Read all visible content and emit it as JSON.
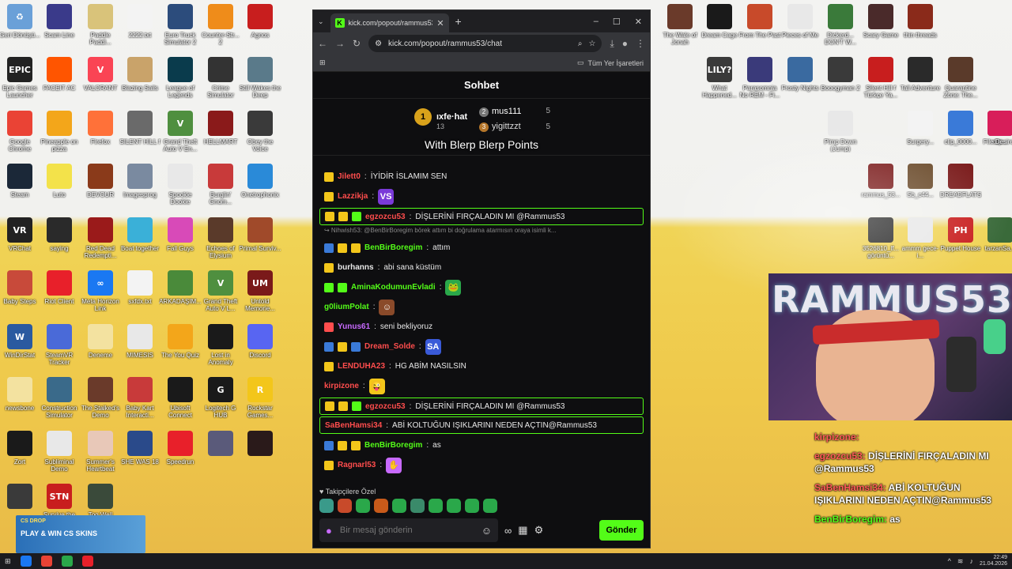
{
  "desktop": {
    "icons": [
      {
        "label": "Geri Dönüşü...",
        "color": "#6aa0d8",
        "glyph": "♻"
      },
      {
        "label": "Scam Line",
        "color": "#3a3a8a",
        "glyph": ""
      },
      {
        "label": "Paddle Paddl...",
        "color": "#d9c37a",
        "glyph": ""
      },
      {
        "label": "2222.txt",
        "color": "#f3f3f3",
        "glyph": ""
      },
      {
        "label": "Euro Truck Simulator 2",
        "color": "#2c4c7c",
        "glyph": ""
      },
      {
        "label": "Counter-Str... 2",
        "color": "#ef8c1a",
        "glyph": ""
      },
      {
        "label": "Agnos",
        "color": "#c81e1e",
        "glyph": ""
      },
      {
        "label": "Epic Games Launcher",
        "color": "#222",
        "glyph": "EPIC"
      },
      {
        "label": "FACEIT AC",
        "color": "#ff5500",
        "glyph": ""
      },
      {
        "label": "VALORANT",
        "color": "#fa4454",
        "glyph": "V"
      },
      {
        "label": "Blazing Sails",
        "color": "#c9a36a",
        "glyph": ""
      },
      {
        "label": "League of Legends",
        "color": "#0a3b4c",
        "glyph": ""
      },
      {
        "label": "Crime Simulator",
        "color": "#333",
        "glyph": ""
      },
      {
        "label": "Still Wakes the Deep",
        "color": "#5a7a8a",
        "glyph": ""
      },
      {
        "label": "Google Chrome",
        "color": "#ea4335",
        "glyph": ""
      },
      {
        "label": "Pineapple on pizza",
        "color": "#f3a61a",
        "glyph": ""
      },
      {
        "label": "Firefox",
        "color": "#ff7139",
        "glyph": ""
      },
      {
        "label": "SILENT HILL f",
        "color": "#6a6a6a",
        "glyph": ""
      },
      {
        "label": "Grand Theft Auto V En...",
        "color": "#4f8f3f",
        "glyph": "V"
      },
      {
        "label": "HELLMART",
        "color": "#8a1a1a",
        "glyph": ""
      },
      {
        "label": "Obey the Voice",
        "color": "#3a3a3a",
        "glyph": ""
      },
      {
        "label": "Steam",
        "color": "#1b2838",
        "glyph": ""
      },
      {
        "label": "Luto",
        "color": "#f3e24a",
        "glyph": ""
      },
      {
        "label": "DEVOUR",
        "color": "#8a3a1a",
        "glyph": ""
      },
      {
        "label": "Imagesprog",
        "color": "#7a8aa0",
        "glyph": ""
      },
      {
        "label": "Spookie Dookie",
        "color": "#e8e8e8",
        "glyph": ""
      },
      {
        "label": "Burglin' Gnom...",
        "color": "#c83a3a",
        "glyph": ""
      },
      {
        "label": "Onetrophonix",
        "color": "#2a8ad8",
        "glyph": ""
      },
      {
        "label": "VRChat",
        "color": "#222",
        "glyph": "VR"
      },
      {
        "label": "saying",
        "color": "#2a2a2a",
        "glyph": ""
      },
      {
        "label": "Red Dead Redempti...",
        "color": "#9a1a1a",
        "glyph": ""
      },
      {
        "label": "Boat together",
        "color": "#3ab0d8",
        "glyph": ""
      },
      {
        "label": "Fall Guys",
        "color": "#d84ab8",
        "glyph": ""
      },
      {
        "label": "Echoes of Elysium",
        "color": "#5a3a2a",
        "glyph": ""
      },
      {
        "label": "Primal Surviv...",
        "color": "#a04a2a",
        "glyph": ""
      },
      {
        "label": "Baby Steps",
        "color": "#c84a3a",
        "glyph": ""
      },
      {
        "label": "Riot Client",
        "color": "#e8202a",
        "glyph": ""
      },
      {
        "label": "Meta Horizon Link",
        "color": "#1a78f2",
        "glyph": "∞"
      },
      {
        "label": "sxfdx.txt",
        "color": "#f3f3f3",
        "glyph": ""
      },
      {
        "label": "ARKADAŞIM...",
        "color": "#4a8a3a",
        "glyph": ""
      },
      {
        "label": "Grand Theft Auto V L...",
        "color": "#4f8f3f",
        "glyph": "V"
      },
      {
        "label": "Untold Memorie...",
        "color": "#7a1a1a",
        "glyph": "UM"
      },
      {
        "label": "WinDirStat",
        "color": "#2a5aa0",
        "glyph": "W"
      },
      {
        "label": "SteamVR Tracker",
        "color": "#4a6ad8",
        "glyph": ""
      },
      {
        "label": "Deneme",
        "color": "#f3e2a0",
        "glyph": ""
      },
      {
        "label": "MIMESIS",
        "color": "#e8e8e8",
        "glyph": ""
      },
      {
        "label": "The You Quiz",
        "color": "#f3a61a",
        "glyph": ""
      },
      {
        "label": "Lost in Anomaly",
        "color": "#1a1a1a",
        "glyph": ""
      },
      {
        "label": "Discord",
        "color": "#5865f2",
        "glyph": ""
      },
      {
        "label": "newsbone",
        "color": "#f3e2a0",
        "glyph": ""
      },
      {
        "label": "Construction Simulator",
        "color": "#3a6a8a",
        "glyph": ""
      },
      {
        "label": "The Stalked's Demo",
        "color": "#6a3a2a",
        "glyph": ""
      },
      {
        "label": "Baby Kart Interacti...",
        "color": "#c83a3a",
        "glyph": ""
      },
      {
        "label": "Ubisoft Connect",
        "color": "#1a1a1a",
        "glyph": ""
      },
      {
        "label": "Logitech G HUB",
        "color": "#1a1a1a",
        "glyph": "G"
      },
      {
        "label": "Rockstar Games...",
        "color": "#f3c61a",
        "glyph": "R"
      },
      {
        "label": "Zort",
        "color": "#1a1a1a",
        "glyph": ""
      },
      {
        "label": "Subliminal Demo",
        "color": "#e8e8e8",
        "glyph": ""
      },
      {
        "label": "Summer's Heartbeat",
        "color": "#e8c8b8",
        "glyph": ""
      },
      {
        "label": "SHE WAS 18",
        "color": "#2a4a8a",
        "glyph": ""
      },
      {
        "label": "Speedrun",
        "color": "#e8202a",
        "glyph": ""
      },
      {
        "label": "",
        "color": "#5a5a7a",
        "glyph": ""
      },
      {
        "label": "",
        "color": "#2a1a1a",
        "glyph": ""
      },
      {
        "label": "",
        "color": "#3a3a3a",
        "glyph": ""
      },
      {
        "label": "Survive the Nights",
        "color": "#c81e1e",
        "glyph": "STN"
      },
      {
        "label": "Too Well Hidden",
        "color": "#3a4a3a",
        "glyph": ""
      }
    ],
    "right_icons": [
      {
        "label": "The Wale of Jonah",
        "color": "#6a3a2a",
        "glyph": ""
      },
      {
        "label": "Dream Cage",
        "color": "#1a1a1a",
        "glyph": ""
      },
      {
        "label": "From The Past",
        "color": "#c84a2a",
        "glyph": ""
      },
      {
        "label": "Pieces of Me",
        "color": "#e8e8e8",
        "glyph": ""
      },
      {
        "label": "Dickerd... DON'T W...",
        "color": "#3a7a3a",
        "glyph": ""
      },
      {
        "label": "Scary Game",
        "color": "#4a2a2a",
        "glyph": ""
      },
      {
        "label": "thin threads",
        "color": "#8a2a1a",
        "glyph": ""
      },
      {
        "label": "What Happened...",
        "color": "#3a3a3a",
        "glyph": "LILY?"
      },
      {
        "label": "Parasomnia No REM - Fi...",
        "color": "#3a3a7a",
        "glyph": ""
      },
      {
        "label": "Frosty Nights",
        "color": "#3a6aa0",
        "glyph": ""
      },
      {
        "label": "Booogyman 2",
        "color": "#3a3a3a",
        "glyph": ""
      },
      {
        "label": "Silent Hill f Türkçe Ya...",
        "color": "#c81e1e",
        "glyph": ""
      },
      {
        "label": "Tall Adventure",
        "color": "#2a2a2a",
        "glyph": ""
      },
      {
        "label": "Quarantine Zone: The...",
        "color": "#5a3a2a",
        "glyph": ""
      },
      {
        "label": "Pimp Down (Jump)",
        "color": "#e8e8e8",
        "glyph": ""
      },
      {
        "label": "Surgery...",
        "color": "#f3f3f3",
        "glyph": ""
      },
      {
        "label": "clip_0000...",
        "color": "#3a7ad8",
        "glyph": ""
      },
      {
        "label": "clip...",
        "color": "#7a3a3a",
        "glyph": ""
      },
      {
        "label": "File Desired",
        "color": "#d81e5a",
        "glyph": ""
      },
      {
        "label": "rammus_53...",
        "color": "#7a1a1a",
        "glyph": ""
      },
      {
        "label": "Sb_c44...",
        "color": "#6a4a2a",
        "glyph": ""
      },
      {
        "label": "DREADFLATS",
        "color": "#7a1a1a",
        "glyph": ""
      },
      {
        "label": "3526810_lf... görüntü...",
        "color": "#2a2a2a",
        "glyph": ""
      },
      {
        "label": "ammm gece-i...",
        "color": "#e8e8e8",
        "glyph": ""
      },
      {
        "label": "Puppet House",
        "color": "#c81e1e",
        "glyph": "PH"
      },
      {
        "label": "tarzanSa...",
        "color": "#3a6a3a",
        "glyph": ""
      }
    ]
  },
  "browser": {
    "tab_title": "kick.com/popout/rammus53/ch",
    "tab_favicon": "K",
    "url": "kick.com/popout/rammus53/chat",
    "bookmarks_label": "Tüm Yer İşaretleri",
    "win_minimize": "–",
    "win_maximize": "☐",
    "win_close": "✕"
  },
  "chat": {
    "header": "Sohbet",
    "leaderboard": {
      "first": {
        "name": "ıxfe·hat",
        "points": "13",
        "rank": "1"
      },
      "second": {
        "name": "mus111",
        "points": "5",
        "rank": "2"
      },
      "third": {
        "name": "yigittzzt",
        "points": "5",
        "rank": "3"
      },
      "title": "With Blerp Blerp Points"
    },
    "messages": [
      {
        "user": "Jilett0",
        "user_color": "#ff4d4d",
        "text": "İYİDİR İSLAMIM SEN",
        "badges": [
          "#f3c61a"
        ],
        "hl": false,
        "emote": ""
      },
      {
        "user": "Lazzikja",
        "user_color": "#ff4d4d",
        "text": "",
        "badges": [
          "#f3c61a"
        ],
        "hl": false,
        "emote": "VS",
        "emote_color": "#7a3ad8"
      },
      {
        "user": "egzozcu53",
        "user_color": "#ff4d4d",
        "text": "DİŞLERİNİ FIRÇALADIN MI @Rammus53",
        "badges": [
          "#f3c61a",
          "#f3c61a",
          "#53fc18"
        ],
        "hl": true,
        "emote": ""
      },
      {
        "reply": "↪ Nihwish53: @BenBirBoregim börek attım bi doğrulama atarmısın oraya isimli k..."
      },
      {
        "user": "BenBirBoregim",
        "user_color": "#53fc18",
        "text": "attım",
        "badges": [
          "#3a7ad8",
          "#f3c61a",
          "#f3c61a"
        ],
        "hl": false,
        "emote": ""
      },
      {
        "user": "burhanns",
        "user_color": "#e8e8e8",
        "text": "abi sana küstüm",
        "badges": [
          "#f3c61a"
        ],
        "hl": false,
        "emote": ""
      },
      {
        "user": "AminaKodumunEvladi",
        "user_color": "#53fc18",
        "text": "",
        "badges": [
          "#53fc18",
          "#53fc18"
        ],
        "hl": false,
        "emote": "🐸",
        "emote_color": "#2aa84a"
      },
      {
        "user": "g0liumPolat",
        "user_color": "#53fc18",
        "text": "",
        "badges": [],
        "hl": false,
        "emote": "☺",
        "emote_color": "#8a4a2a"
      },
      {
        "user": "Yunus61",
        "user_color": "#c86aff",
        "text": "seni bekliyoruz",
        "badges": [
          "#ff4d4d"
        ],
        "hl": false,
        "emote": ""
      },
      {
        "user": "Dream_Solde",
        "user_color": "#ff4d4d",
        "text": "",
        "badges": [
          "#3a7ad8",
          "#f3c61a",
          "#3a7ad8"
        ],
        "hl": false,
        "emote": "SA",
        "emote_color": "#3a5ad8"
      },
      {
        "user": "LENDUHA23",
        "user_color": "#ff4d4d",
        "text": "HG ABİM NASILSIN",
        "badges": [
          "#f3c61a"
        ],
        "hl": false,
        "emote": ""
      },
      {
        "user": "kirpizone",
        "user_color": "#ff4d4d",
        "text": "",
        "badges": [],
        "hl": false,
        "emote": "😜",
        "emote_color": "#f3c61a"
      },
      {
        "user": "egzozcu53",
        "user_color": "#ff4d4d",
        "text": "DİŞLERİNİ FIRÇALADIN MI @Rammus53",
        "badges": [
          "#f3c61a",
          "#f3c61a",
          "#53fc18"
        ],
        "hl": true,
        "emote": ""
      },
      {
        "user": "SaBenHamsi34",
        "user_color": "#ff4d4d",
        "text": "ABİ KOLTUĞUN IŞIKLARINI NEDEN AÇTIN@Rammus53",
        "badges": [],
        "hl": true,
        "emote": ""
      },
      {
        "user": "BenBirBoregim",
        "user_color": "#53fc18",
        "text": "as",
        "badges": [
          "#3a7ad8",
          "#f3c61a",
          "#f3c61a"
        ],
        "hl": false,
        "emote": ""
      },
      {
        "user": "Ragnarl53",
        "user_color": "#ff4d4d",
        "text": "",
        "badges": [
          "#f3c61a"
        ],
        "hl": false,
        "emote": "✋",
        "emote_color": "#c86aff"
      }
    ],
    "followers_label": "Takipçilere Özel",
    "input_placeholder": "Bir mesaj gönderin",
    "send_label": "Gönder"
  },
  "overlay": {
    "cam_word": "RAMMUS53",
    "messages": [
      {
        "user": "kirpizone:",
        "text": ""
      },
      {
        "user": "egzozcu53:",
        "text": "DİŞLERİNİ FIRÇALADIN MI @Rammus53"
      },
      {
        "user": "SaBenHamsi34:",
        "text": "ABİ KOLTUĞUN IŞIKLARINI NEDEN AÇTIN@Rammus53"
      },
      {
        "user": "BenBirBoregim:",
        "text": "as"
      }
    ]
  },
  "promo": {
    "tag": "CS DROP",
    "text": "PLAY & WIN CS SKINS"
  },
  "taskbar": {
    "time": "22:49",
    "date": "21.04.2026"
  }
}
